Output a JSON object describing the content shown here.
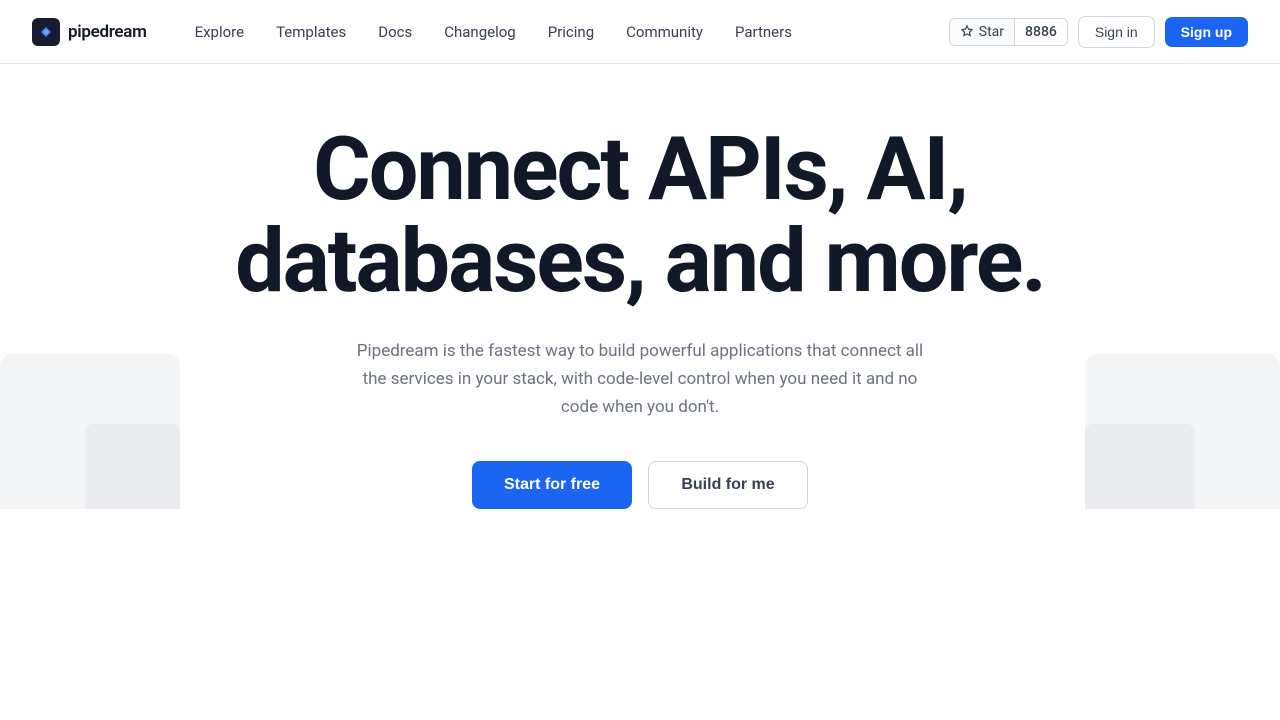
{
  "nav": {
    "logo_text": "pipedream",
    "links": [
      {
        "label": "Explore",
        "id": "explore"
      },
      {
        "label": "Templates",
        "id": "templates"
      },
      {
        "label": "Docs",
        "id": "docs"
      },
      {
        "label": "Changelog",
        "id": "changelog"
      },
      {
        "label": "Pricing",
        "id": "pricing"
      },
      {
        "label": "Community",
        "id": "community"
      },
      {
        "label": "Partners",
        "id": "partners"
      }
    ],
    "star_label": "Star",
    "star_count": "8886",
    "signin_label": "Sign in",
    "signup_label": "Sign up"
  },
  "hero": {
    "title": "Connect APIs, AI, databases, and more.",
    "subtitle": "Pipedream is the fastest way to build powerful applications that connect all the services in your stack, with code-level control when you need it and no code when you don't.",
    "btn_primary": "Start for free",
    "btn_secondary": "Build for me"
  }
}
